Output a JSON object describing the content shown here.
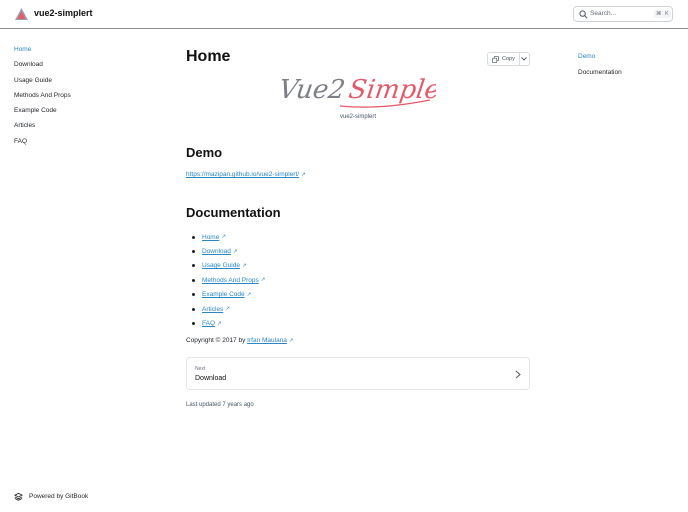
{
  "header": {
    "site_title": "vue2-simplert",
    "search_placeholder": "Search...",
    "shortcut_cmd": "⌘",
    "shortcut_key": "K"
  },
  "sidebar": {
    "items": [
      {
        "label": "Home",
        "active": true
      },
      {
        "label": "Download",
        "active": false
      },
      {
        "label": "Usage Guide",
        "active": false
      },
      {
        "label": "Methods And Props",
        "active": false
      },
      {
        "label": "Example Code",
        "active": false
      },
      {
        "label": "Articles",
        "active": false
      },
      {
        "label": "FAQ",
        "active": false
      }
    ],
    "powered_by": "Powered by GitBook"
  },
  "main": {
    "title": "Home",
    "copy_label": "Copy",
    "banner_text": "Vue2 Simplert",
    "banner_caption": "vue2-simplert",
    "demo_heading": "Demo",
    "demo_link": "https://mazipan.github.io/vue2-simplert/",
    "documentation_heading": "Documentation",
    "doc_links": [
      "Home",
      "Download",
      "Usage Guide",
      "Methods And Props",
      "Example Code",
      "Articles",
      "FAQ"
    ],
    "copyright_prefix": "Copyright © 2017 by ",
    "copyright_author": "Irfan Maulana",
    "next_small": "Next",
    "next_title": "Download",
    "last_updated": "Last updated 7 years ago"
  },
  "toc": {
    "items": [
      {
        "label": "Demo",
        "active": true
      },
      {
        "label": "Documentation",
        "active": false
      }
    ]
  },
  "colors": {
    "accent": "#2b86c5",
    "banner_gray": "#7d7f86",
    "banner_pink": "#e35a6b"
  },
  "icons": {
    "logo": "triangle-logo-icon",
    "search": "search-icon",
    "copy": "copy-icon",
    "dropdown": "chevron-down-icon",
    "external": "external-link-icon",
    "next": "chevron-right-icon",
    "gitbook": "gitbook-icon"
  }
}
